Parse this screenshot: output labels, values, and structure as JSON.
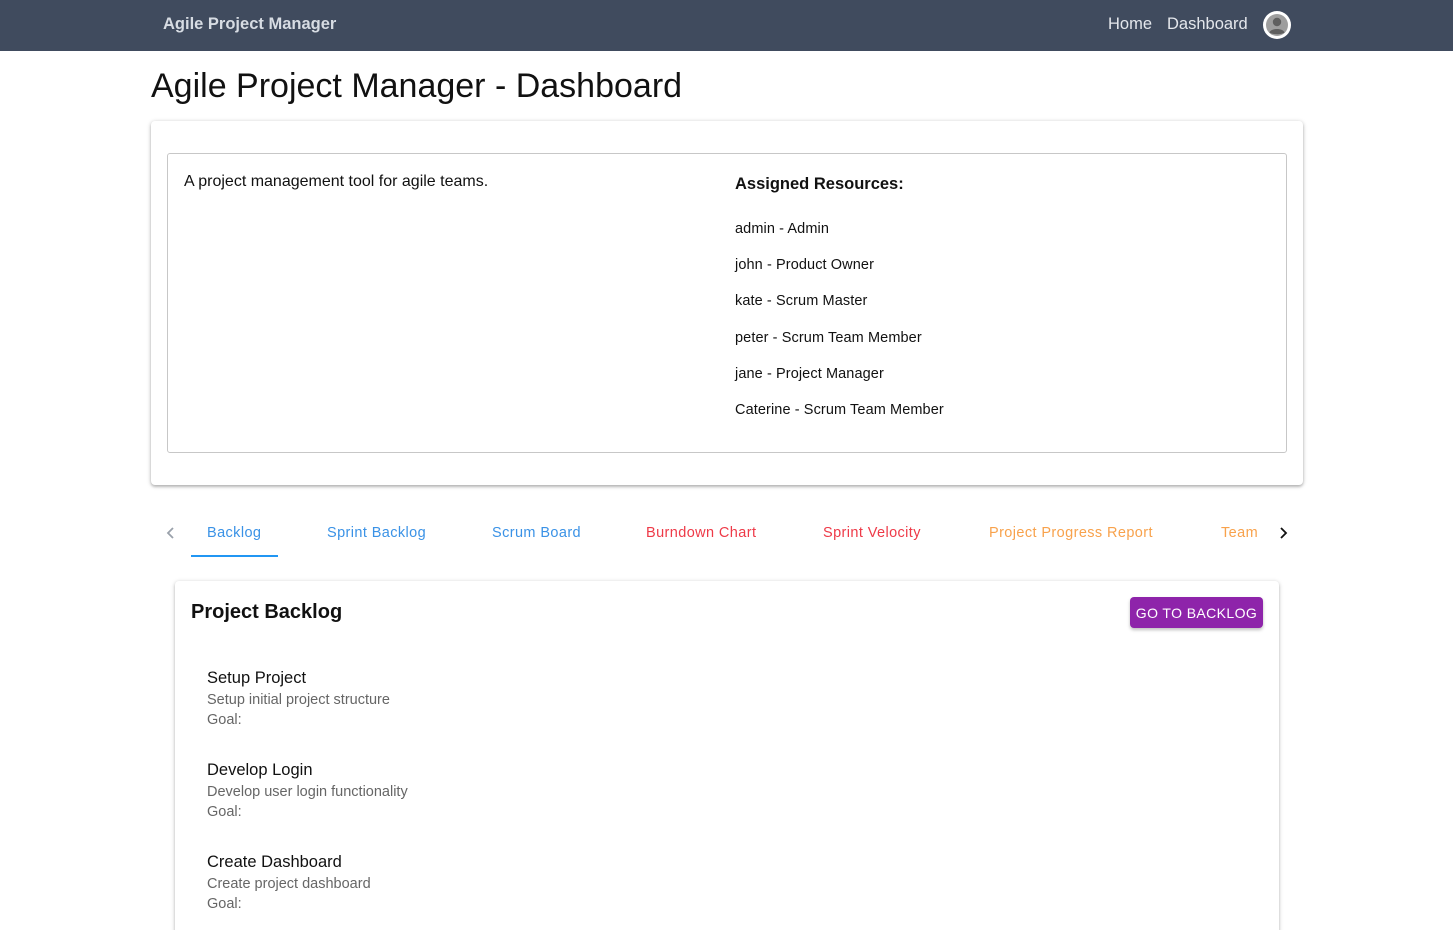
{
  "navbar": {
    "brand": "Agile Project Manager",
    "links": [
      "Home",
      "Dashboard"
    ],
    "avatar_icon": "user-avatar-icon",
    "background": "#404b5e"
  },
  "page": {
    "title": "Agile Project Manager - Dashboard"
  },
  "project": {
    "description": "A project management tool for agile teams.",
    "resources_title": "Assigned Resources:",
    "resources": [
      "admin - Admin",
      "john - Product Owner",
      "kate - Scrum Master",
      "peter - Scrum Team Member",
      "jane - Project Manager",
      "Caterine - Scrum Team Member"
    ]
  },
  "tabs": {
    "scroll_left_icon": "chevron-left-icon",
    "scroll_right_icon": "chevron-right-icon",
    "selected": "Backlog",
    "items": [
      {
        "label": "Backlog",
        "color": "#3a92e6"
      },
      {
        "label": "Sprint Backlog",
        "color": "#3a92e6"
      },
      {
        "label": "Scrum Board",
        "color": "#3a92e6"
      },
      {
        "label": "Burndown Chart",
        "color": "#ee3a48"
      },
      {
        "label": "Sprint Velocity",
        "color": "#ee3a48"
      },
      {
        "label": "Project Progress Report",
        "color": "#f8a24c"
      },
      {
        "label": "Team",
        "color": "#f8a24c"
      }
    ],
    "indicator_color": "#2196f3"
  },
  "backlog": {
    "title": "Project Backlog",
    "button_label": "GO TO BACKLOG",
    "button_color": "#8e24aa",
    "items": [
      {
        "title": "Setup Project",
        "description": "Setup initial project structure",
        "goal": "Goal:"
      },
      {
        "title": "Develop Login",
        "description": "Develop user login functionality",
        "goal": "Goal:"
      },
      {
        "title": "Create Dashboard",
        "description": "Create project dashboard",
        "goal": "Goal:"
      }
    ]
  }
}
